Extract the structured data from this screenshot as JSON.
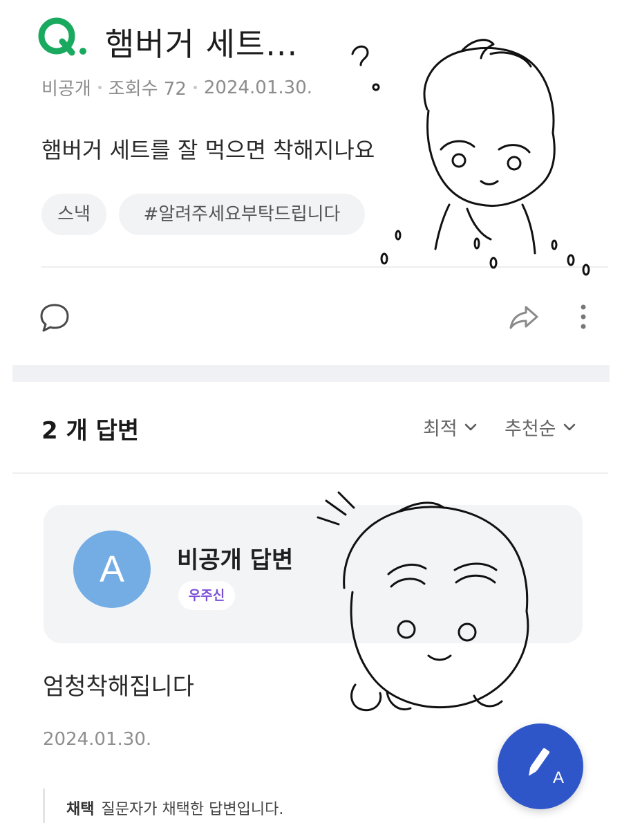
{
  "question": {
    "mark": "Q.",
    "title": "햄버거 세트...",
    "visibility": "비공개",
    "views": "조회수 72",
    "date": "2024.01.30.",
    "body": "햄버거 세트를 잘 먹으면 착해지나요",
    "tags": [
      "스낵",
      "#알려주세요부탁드립니다"
    ]
  },
  "actions": {
    "comment_icon": "comment-icon",
    "share_icon": "share-icon",
    "more_icon": "more-vertical-icon"
  },
  "answers_header": {
    "count_label": "2 개 답변",
    "sort_primary": "최적",
    "sort_secondary": "추천순"
  },
  "answer": {
    "avatar_letter": "A",
    "author": "비공개 답변",
    "badge": "우주신",
    "body": "엄청착해집니다",
    "date": "2024.01.30.",
    "chosen_label": "채택",
    "chosen_text": "질문자가 채택한 답변입니다."
  },
  "fab": {
    "icon": "write-answer-icon",
    "letter": "A"
  },
  "colors": {
    "q_mark": "#1aaa5f",
    "avatar": "#74ace4",
    "badge_text": "#7b4fd6",
    "fab": "#2f56c8"
  }
}
